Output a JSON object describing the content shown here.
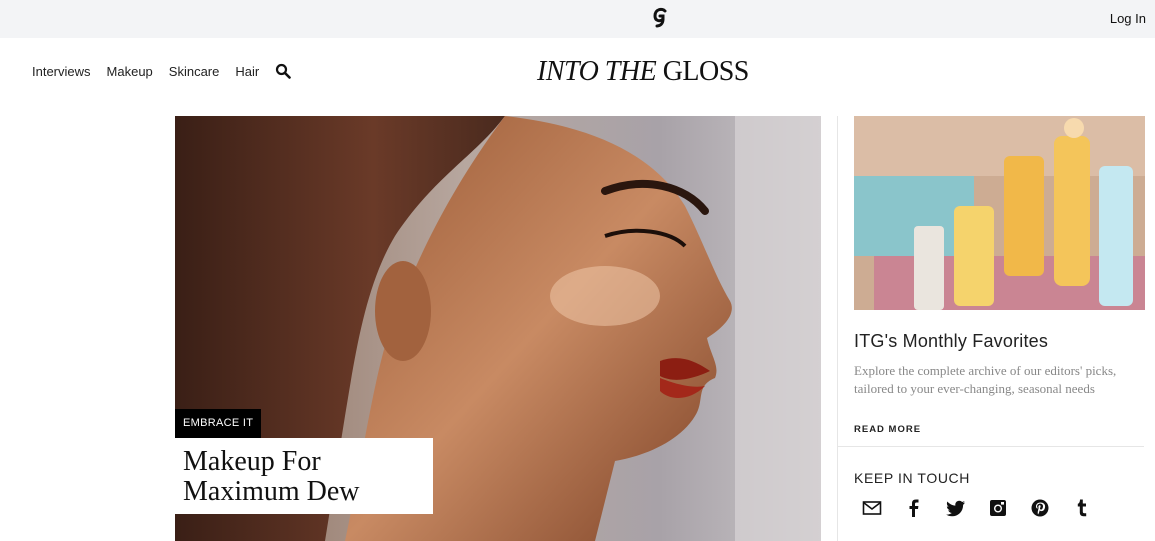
{
  "topbar": {
    "login_label": "Log In",
    "logo_icon": "glossier-g-icon"
  },
  "nav": {
    "links": [
      "Interviews",
      "Makeup",
      "Skincare",
      "Hair"
    ],
    "search_icon": "search-icon",
    "brand_italic": "INTO THE",
    "brand_roman": "GLOSS"
  },
  "feature": {
    "tag": "EMBRACE IT",
    "headline_line1": "Makeup For",
    "headline_line2": "Maximum Dew"
  },
  "sidebar": {
    "title": "ITG's Monthly Favorites",
    "description": "Explore the complete archive of our editors' picks, tailored to your ever-changing, seasonal needs",
    "read_more": "READ MORE",
    "keep_in_touch": "KEEP IN TOUCH",
    "social_icons": [
      "email-icon",
      "facebook-icon",
      "twitter-icon",
      "instagram-icon",
      "pinterest-icon",
      "tumblr-icon"
    ]
  },
  "colors": {
    "topbar_bg": "#f3f4f6",
    "tag_bg": "#000000",
    "muted_text": "#888888"
  }
}
